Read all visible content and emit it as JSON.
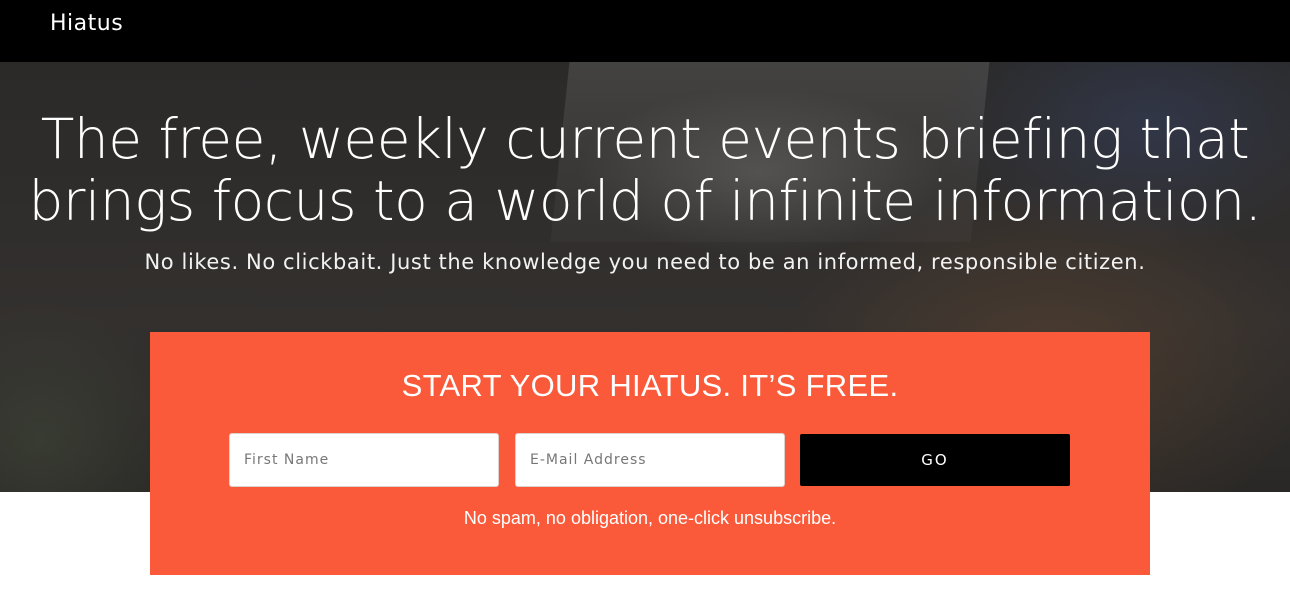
{
  "header": {
    "brand": "Hiatus"
  },
  "hero": {
    "title_line1": "The free, weekly current events briefing that",
    "title_line2": "brings focus to a world of infinite information.",
    "subtitle": "No likes. No clickbait. Just the knowledge you need to be an informed, responsible citizen."
  },
  "signup": {
    "heading": "START YOUR HIATUS. IT’S FREE.",
    "first_name_placeholder": "First Name",
    "first_name_value": "",
    "email_placeholder": "E-Mail Address",
    "email_value": "",
    "submit_label": "GO",
    "note": "No spam, no obligation, one-click unsubscribe."
  },
  "colors": {
    "topbar": "#000000",
    "accent": "#fb5a3a",
    "button": "#000000"
  }
}
